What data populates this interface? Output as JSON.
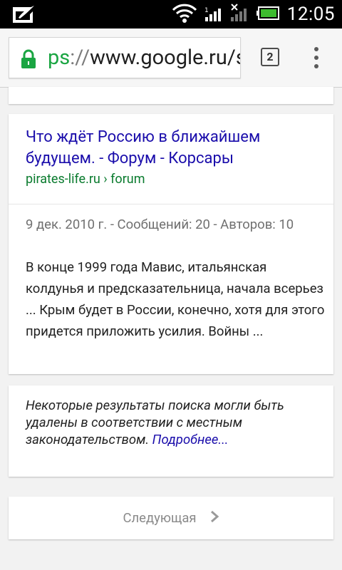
{
  "status_bar": {
    "time": "12:05",
    "icons": [
      "notification-icon",
      "wifi-icon",
      "signal-icon",
      "signal-no-sim-icon",
      "battery-icon"
    ]
  },
  "toolbar": {
    "url_scheme": "ps",
    "url_separator": "://",
    "url_host": "www.google.ru/s",
    "tab_count": "2",
    "lock_color": "#1aa542"
  },
  "result": {
    "title": "Что ждёт Россию в ближайшем будущем. - Форум - Корсары",
    "url": "pirates-life.ru › forum",
    "meta": "9 дек. 2010 г. - Сообщений: 20 - Авторов: 10",
    "snippet": "В конце 1999 года Мавис, итальянская колдунья и предсказательница, начала всерьез ... Крым будет в России, конечно, хотя для этого придется приложить усилия. Войны ..."
  },
  "notice": {
    "text": "Некоторые результаты поиска могли быть удалены в соответствии с местным законодательством.",
    "link": "Подробнее..."
  },
  "pagination": {
    "next_label": "Следующая"
  },
  "colors": {
    "link": "#1a0dab",
    "url_green": "#0a7b2e",
    "background": "#f2f2f2"
  }
}
